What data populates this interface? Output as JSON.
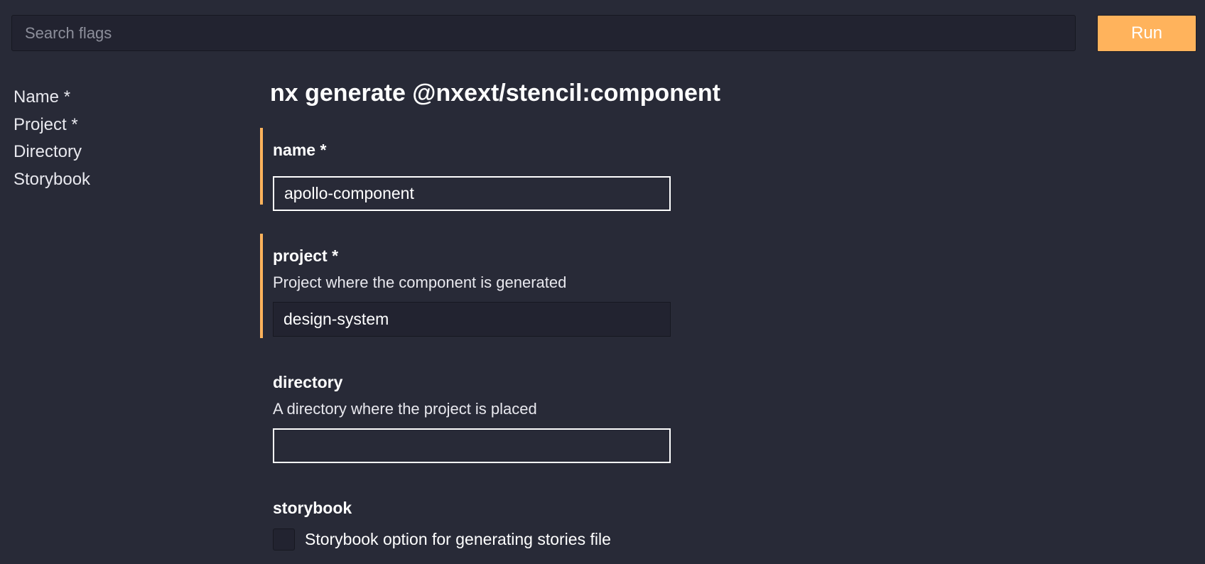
{
  "search": {
    "placeholder": "Search flags",
    "value": ""
  },
  "toolbar": {
    "run_label": "Run"
  },
  "sidebar": {
    "items": [
      {
        "label": "Name *"
      },
      {
        "label": "Project *"
      },
      {
        "label": "Directory"
      },
      {
        "label": "Storybook"
      }
    ]
  },
  "main": {
    "title": "nx generate @nxext/stencil:component",
    "fields": {
      "name": {
        "label": "name *",
        "value": "apollo-component"
      },
      "project": {
        "label": "project *",
        "description": "Project where the component is generated",
        "value": "design-system"
      },
      "directory": {
        "label": "directory",
        "description": "A directory where the project is placed",
        "value": ""
      },
      "storybook": {
        "label": "storybook",
        "description": "Storybook option for generating stories file"
      }
    }
  },
  "colors": {
    "background": "#282a37",
    "accent": "#ffb35c",
    "input_dark": "#222330"
  }
}
